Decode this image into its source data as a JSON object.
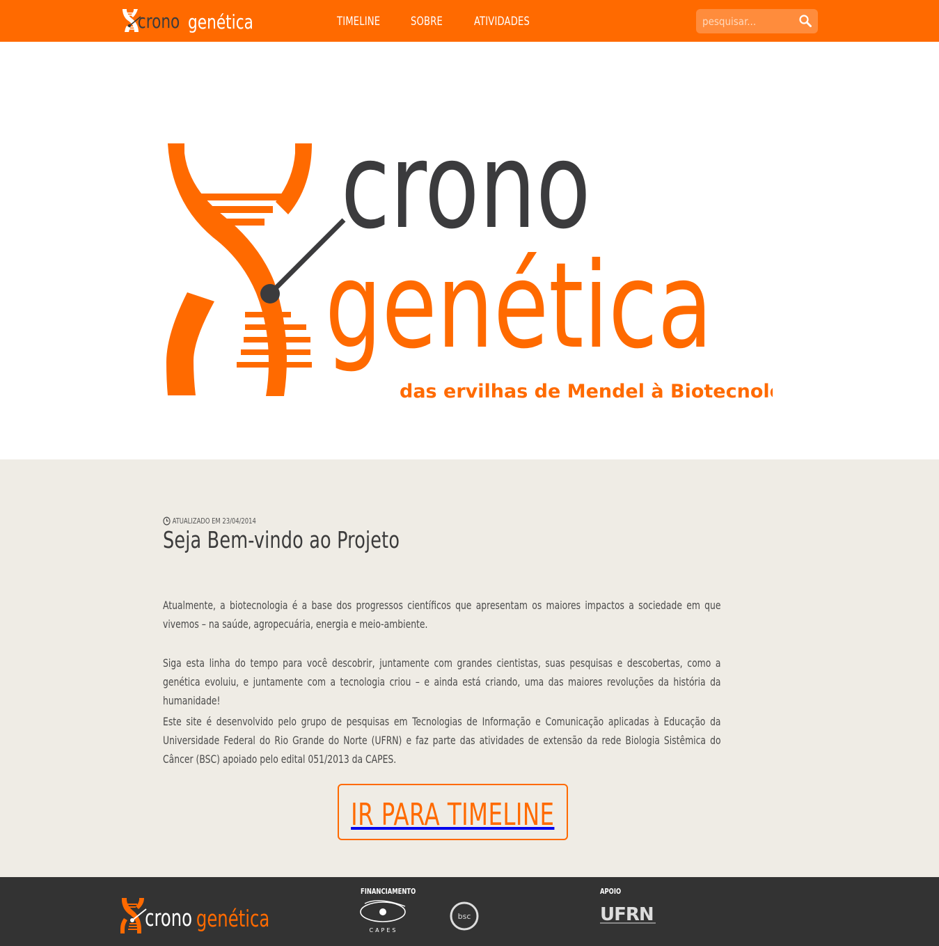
{
  "header": {
    "logo_text": {
      "crono": "crono",
      "genetica": "genética"
    },
    "nav": [
      {
        "label": "TIMELINE"
      },
      {
        "label": "SOBRE"
      },
      {
        "label": "ATIVIDADES"
      }
    ],
    "search": {
      "placeholder": "pesquisar..."
    }
  },
  "hero": {
    "logo_crono": "crono",
    "logo_genetica": "genética",
    "tagline": "das ervilhas de Mendel à Biotecnologia"
  },
  "main": {
    "updated": "ATUALIZADO EM 23/04/2014",
    "title": "Seja Bem-vindo ao Projeto",
    "paragraphs": [
      "Atualmente, a biotecnologia é a base dos progressos científicos que apresentam os maiores impactos a sociedade em que vivemos – na saúde, agropecuária, energia e meio-ambiente.",
      "Siga esta linha do tempo para você descobrir, juntamente com grandes cientistas, suas pesquisas e descobertas, como a genética evoluiu, e juntamente com a tecnologia criou – e ainda está criando, uma das maiores revoluções da história da humanidade!",
      "Este site é desenvolvido pelo grupo de pesquisas em Tecnologias de Informação e Comunicação aplicadas à Educação da Universidade Federal do Rio Grande do Norte (UFRN) e faz parte das atividades de extensão da rede Biologia Sistêmica do Câncer (BSC) apoiado pelo edital 051/2013 da CAPES."
    ],
    "cta_label": "IR PARA TIMELINE"
  },
  "footer": {
    "logo_text": {
      "crono": "crono",
      "genetica": "genética"
    },
    "financing_label": "FINANCIAMENTO",
    "support_label": "APOIO",
    "capes_text": "CAPES",
    "bsc_text": "bsc",
    "ufrn_text": "UFRN"
  },
  "colors": {
    "brand_orange": "#ff6a00",
    "dark_text": "#3b3b3d",
    "content_bg": "#efece5",
    "footer_bg": "#333333"
  },
  "icons": {
    "search": "search-icon",
    "clock": "clock-icon",
    "dna": "dna-helix-icon"
  }
}
